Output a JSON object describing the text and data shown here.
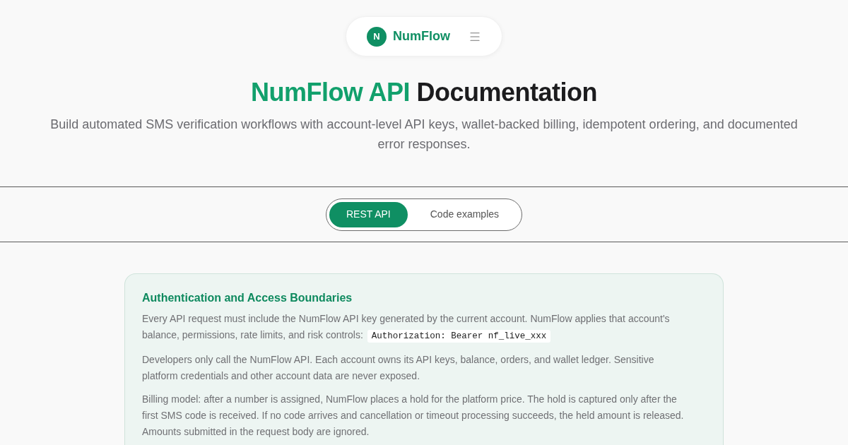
{
  "nav": {
    "logo_letter": "N",
    "brand": "NumFlow"
  },
  "hero": {
    "title_highlight": "NumFlow API",
    "title_rest": "Documentation",
    "subtitle": "Build automated SMS verification workflows with account-level API keys, wallet-backed billing, idempotent ordering, and documented error responses."
  },
  "tabs": [
    {
      "label": "REST API",
      "selected": true
    },
    {
      "label": "Code examples",
      "selected": false
    }
  ],
  "section": {
    "title": "Authentication and Access Boundaries",
    "paragraphs": [
      {
        "text": "Every API request must include the NumFlow API key generated by the current account. NumFlow applies that account's balance, permissions, rate limits, and risk controls:",
        "code": "Authorization: Bearer nf_live_xxx"
      },
      {
        "text": "Developers only call the NumFlow API. Each account owns its API keys, balance, orders, and wallet ledger. Sensitive platform credentials and other account data are never exposed."
      },
      {
        "text": "Billing model: after a number is assigned, NumFlow places a hold for the platform price. The hold is captured only after the first SMS code is received. If no code arrives and cancellation or timeout processing succeeds, the held amount is released. Amounts submitted in the request body are ignored."
      }
    ]
  }
}
